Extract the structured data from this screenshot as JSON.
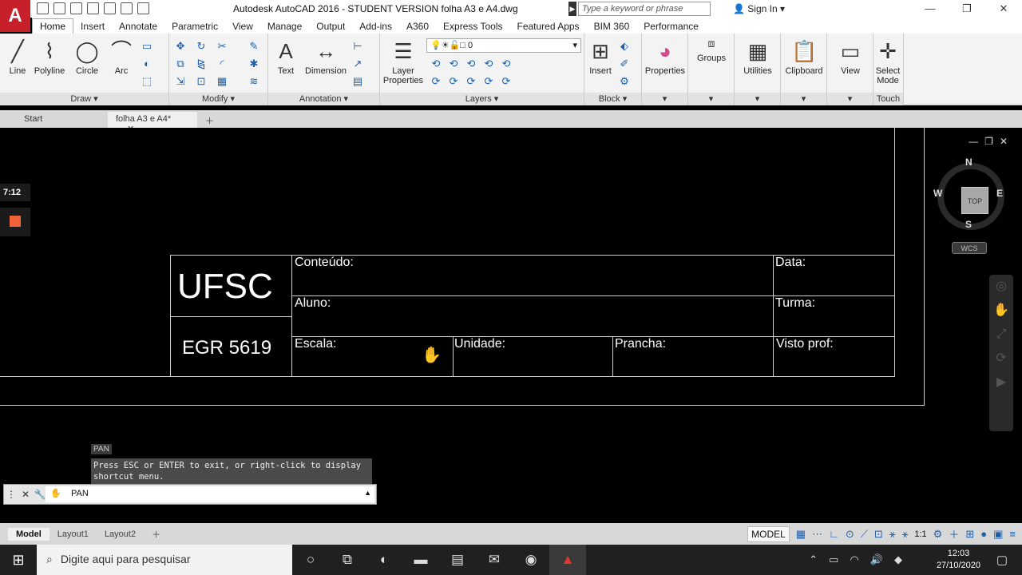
{
  "window": {
    "title": "Autodesk AutoCAD 2016 - STUDENT VERSION     folha A3 e A4.dwg",
    "search_placeholder": "Type a keyword or phrase",
    "sign_in": "Sign In"
  },
  "ribbon_tabs": [
    "Home",
    "Insert",
    "Annotate",
    "Parametric",
    "View",
    "Manage",
    "Output",
    "Add-ins",
    "A360",
    "Express Tools",
    "Featured Apps",
    "BIM 360",
    "Performance"
  ],
  "ribbon": {
    "draw": {
      "label": "Draw ▾",
      "line": "Line",
      "polyline": "Polyline",
      "circle": "Circle",
      "arc": "Arc"
    },
    "modify": {
      "label": "Modify ▾"
    },
    "annotation": {
      "label": "Annotation ▾",
      "text": "Text",
      "dimension": "Dimension"
    },
    "layers": {
      "label": "Layers ▾",
      "layer_properties_1": "Layer",
      "layer_properties_2": "Properties",
      "current_layer": "0"
    },
    "block": {
      "label": "Block ▾",
      "insert": "Insert"
    },
    "properties": "Properties",
    "groups": "Groups",
    "utilities": "Utilities",
    "clipboard": "Clipboard",
    "view": "View",
    "select_mode_1": "Select",
    "select_mode_2": "Mode",
    "touch": "Touch"
  },
  "doc_tabs": {
    "start": "Start",
    "active": "folha A3 e A4*"
  },
  "titleblock": {
    "ufsc": "UFSC",
    "course": "EGR 5619",
    "conteudo": "Conteúdo:",
    "data": "Data:",
    "aluno": "Aluno:",
    "turma": "Turma:",
    "escala": "Escala:",
    "unidade": "Unidade:",
    "prancha": "Prancha:",
    "visto": "Visto prof:"
  },
  "recorder": {
    "time": "7:12"
  },
  "viewcube": {
    "n": "N",
    "s": "S",
    "e": "E",
    "w": "W",
    "top": "TOP",
    "wcs": "WCS"
  },
  "command": {
    "pan_label": "PAN",
    "tooltip": "Press ESC or ENTER to exit, or right-click to display shortcut menu.",
    "input": "PAN"
  },
  "layout_tabs": [
    "Model",
    "Layout1",
    "Layout2"
  ],
  "status": {
    "model": "MODEL",
    "scale": "1:1"
  },
  "taskbar": {
    "search": "Digite aqui para pesquisar",
    "time": "12:03",
    "date": "27/10/2020"
  }
}
